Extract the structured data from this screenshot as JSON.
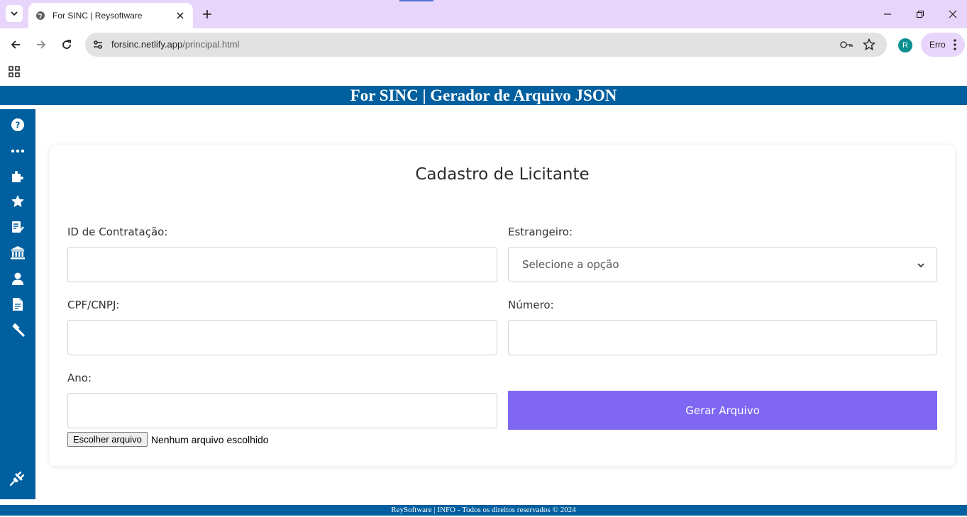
{
  "browser": {
    "tab_title": "For SINC | Reysoftware",
    "url_domain": "forsinc.netlify.app",
    "url_path": "/principal.html",
    "profile_initial": "R",
    "profile_status": "Erro"
  },
  "header": {
    "title": "For SINC | Gerador de Arquivo JSON"
  },
  "sidebar": {
    "items": [
      {
        "icon": "help-icon"
      },
      {
        "icon": "more-icon"
      },
      {
        "icon": "puzzle-icon"
      },
      {
        "icon": "star-icon"
      },
      {
        "icon": "checklist-icon"
      },
      {
        "icon": "bank-icon"
      },
      {
        "icon": "user-icon"
      },
      {
        "icon": "document-icon"
      },
      {
        "icon": "gavel-icon"
      },
      {
        "icon": "plug-icon"
      }
    ]
  },
  "form": {
    "title": "Cadastro de Licitante",
    "id_label": "ID de Contratação:",
    "id_value": "",
    "estrangeiro_label": "Estrangeiro:",
    "estrangeiro_selected": "Selecione a opção",
    "cpf_label": "CPF/CNPJ:",
    "cpf_value": "",
    "numero_label": "Número:",
    "numero_value": "",
    "ano_label": "Ano:",
    "ano_value": "",
    "generate_button": "Gerar Arquivo",
    "file_button": "Escolher arquivo",
    "file_status": "Nenhum arquivo escolhido"
  },
  "footer": {
    "text": "ReySoftware | INFO - Todos os direitos reservados © 2024"
  },
  "colors": {
    "brand_blue": "#005f9e",
    "button_purple": "#8067f3",
    "chrome_purple": "#e8d5fb"
  }
}
